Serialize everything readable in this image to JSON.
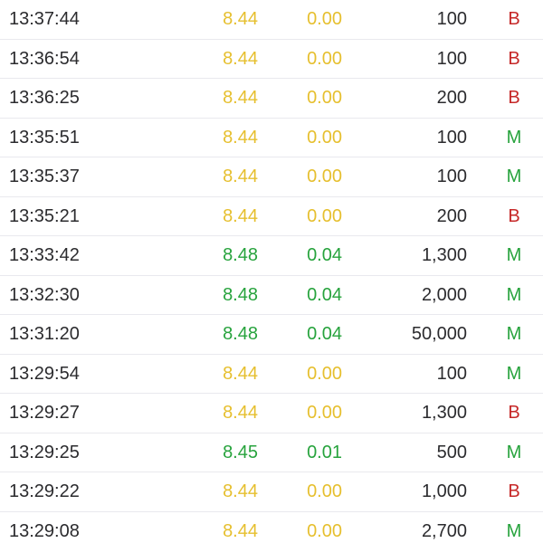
{
  "colors": {
    "flat": "#e6bf2e",
    "up": "#27a33d",
    "side_b": "#c62828",
    "side_m": "#27a33d",
    "text": "#2b2b2e",
    "divider": "#e9e9ee"
  },
  "trades": [
    {
      "time": "13:37:44",
      "price": "8.44",
      "change": "0.00",
      "volume": "100",
      "side": "B",
      "trend": "flat"
    },
    {
      "time": "13:36:54",
      "price": "8.44",
      "change": "0.00",
      "volume": "100",
      "side": "B",
      "trend": "flat"
    },
    {
      "time": "13:36:25",
      "price": "8.44",
      "change": "0.00",
      "volume": "200",
      "side": "B",
      "trend": "flat"
    },
    {
      "time": "13:35:51",
      "price": "8.44",
      "change": "0.00",
      "volume": "100",
      "side": "M",
      "trend": "flat"
    },
    {
      "time": "13:35:37",
      "price": "8.44",
      "change": "0.00",
      "volume": "100",
      "side": "M",
      "trend": "flat"
    },
    {
      "time": "13:35:21",
      "price": "8.44",
      "change": "0.00",
      "volume": "200",
      "side": "B",
      "trend": "flat"
    },
    {
      "time": "13:33:42",
      "price": "8.48",
      "change": "0.04",
      "volume": "1,300",
      "side": "M",
      "trend": "up"
    },
    {
      "time": "13:32:30",
      "price": "8.48",
      "change": "0.04",
      "volume": "2,000",
      "side": "M",
      "trend": "up"
    },
    {
      "time": "13:31:20",
      "price": "8.48",
      "change": "0.04",
      "volume": "50,000",
      "side": "M",
      "trend": "up"
    },
    {
      "time": "13:29:54",
      "price": "8.44",
      "change": "0.00",
      "volume": "100",
      "side": "M",
      "trend": "flat"
    },
    {
      "time": "13:29:27",
      "price": "8.44",
      "change": "0.00",
      "volume": "1,300",
      "side": "B",
      "trend": "flat"
    },
    {
      "time": "13:29:25",
      "price": "8.45",
      "change": "0.01",
      "volume": "500",
      "side": "M",
      "trend": "up"
    },
    {
      "time": "13:29:22",
      "price": "8.44",
      "change": "0.00",
      "volume": "1,000",
      "side": "B",
      "trend": "flat"
    },
    {
      "time": "13:29:08",
      "price": "8.44",
      "change": "0.00",
      "volume": "2,700",
      "side": "M",
      "trend": "flat"
    }
  ]
}
